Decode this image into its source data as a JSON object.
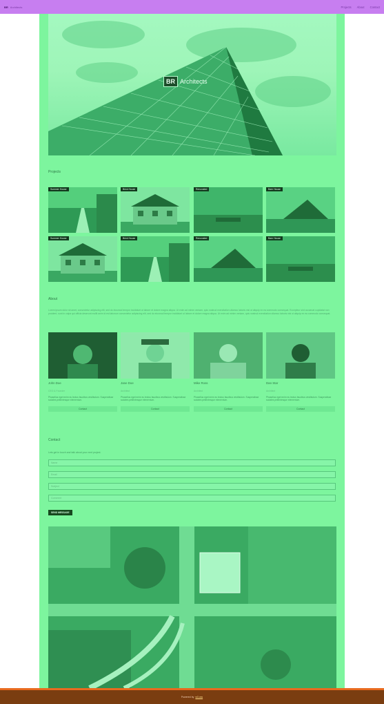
{
  "navbar": {
    "brand_mark": "BR",
    "brand_name": "Architects",
    "links": [
      "Projects",
      "About",
      "Contact"
    ]
  },
  "hero": {
    "logo_mark": "BR",
    "logo_text": "Architects"
  },
  "projects": {
    "title": "Projects",
    "items": [
      {
        "tag": "Summer House"
      },
      {
        "tag": "Brick House"
      },
      {
        "tag": "Renovated"
      },
      {
        "tag": "Barn House"
      },
      {
        "tag": "Summer House"
      },
      {
        "tag": "Brick House"
      },
      {
        "tag": "Renovated"
      },
      {
        "tag": "Barn House"
      }
    ]
  },
  "about": {
    "title": "About",
    "text": "Lorem ipsum dolor sit amet, consectetur adipiscing elit, sed do eiusmod tempor incididunt ut labore et dolore magna aliqua. Ut enim ad minim veniam, quis nostrud exercitation ullamco laboris nisi ut aliquip ex ea commodo consequat. Excepteur sint occaecat cupidatat non proident, sunt in culpa qui officia deserunt mollit anim id est laborum consectetur adipiscing elit, sed do eiusmod tempor incididunt ut labore et dolore magna aliqua. Ut enim ad minim veniam, quis nostrud exercitation ullamco laboris nisi ut aliquip ex ea commodo consequat."
  },
  "team": [
    {
      "name": "John Doe",
      "role": "CEO & Founder",
      "desc": "Phasellus eget enim eu lectus faucibus vestibulum. Suspendisse sodales pellentesque elementum.",
      "button": "Contact"
    },
    {
      "name": "Jane Doe",
      "role": "Architect",
      "desc": "Phasellus eget enim eu lectus faucibus vestibulum. Suspendisse sodales pellentesque elementum.",
      "button": "Contact"
    },
    {
      "name": "Mike Ross",
      "role": "Architect",
      "desc": "Phasellus eget enim eu lectus faucibus vestibulum. Suspendisse sodales pellentesque elementum.",
      "button": "Contact"
    },
    {
      "name": "Dan Star",
      "role": "Architect",
      "desc": "Phasellus eget enim eu lectus faucibus vestibulum. Suspendisse sodales pellentesque elementum.",
      "button": "Contact"
    }
  ],
  "contact": {
    "title": "Contact",
    "subtitle": "Lets get in touch and talk about your next project.",
    "fields": [
      {
        "placeholder": "Name"
      },
      {
        "placeholder": "Email"
      },
      {
        "placeholder": "Subject"
      },
      {
        "placeholder": "Comment"
      }
    ],
    "send_label": "SEND MESSAGE"
  },
  "footer": {
    "text": "Powered by",
    "link": "w3.css"
  },
  "colors": {
    "navbar": "#c77ef0",
    "content_overlay": "#7df59e",
    "footer": "#7a3d10",
    "footer_border": "#e86a1f",
    "dark_accent": "#17481f"
  }
}
